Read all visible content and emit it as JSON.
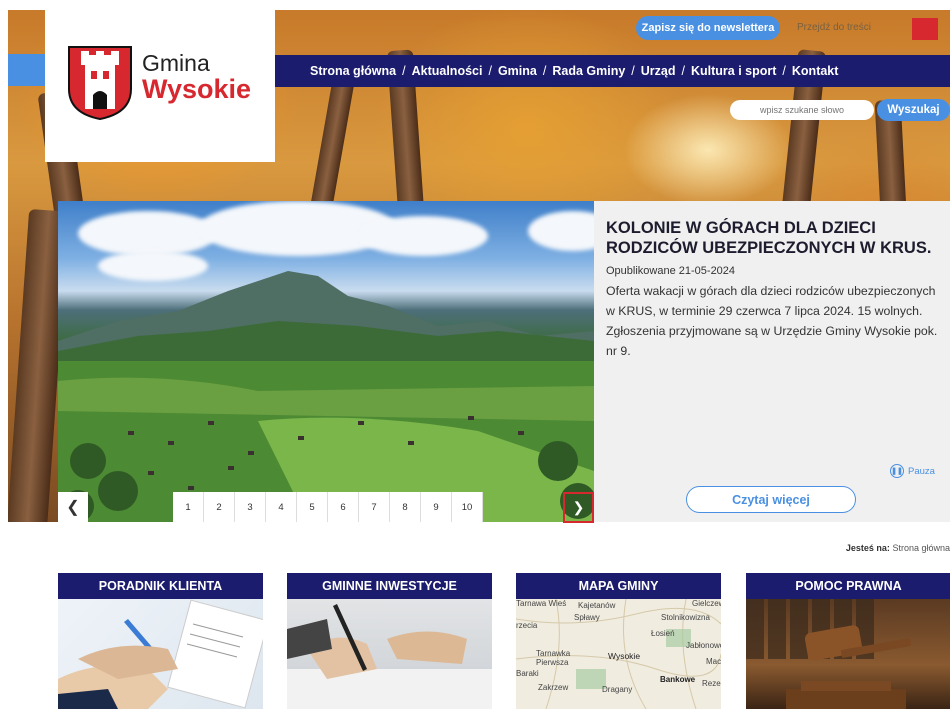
{
  "header": {
    "logo_line1": "Gmina",
    "logo_line2": "Wysokie",
    "newsletter_label": "Zapisz się do newslettera",
    "skip_label": "Przejdź do treści"
  },
  "nav": {
    "items": [
      "Strona główna",
      "Aktualności",
      "Gmina",
      "Rada Gminy",
      "Urząd",
      "Kultura i sport",
      "Kontakt"
    ],
    "separator": "/"
  },
  "search": {
    "placeholder": "wpisz szukane słowo",
    "button_label": "Wyszukaj"
  },
  "slider": {
    "title": "KOLONIE W GÓRACH DLA DZIECI RODZICÓW UBEZPIECZONYCH W KRUS.",
    "date": "Opublikowane 21-05-2024",
    "body": "Oferta wakacji w górach dla dzieci rodziców ubezpieczonych w KRUS, w terminie 29 czerwca 7 lipca 2024. 15 wolnych. Zgłoszenia przyjmowane są w Urzędzie Gminy Wysokie pok. nr 9.",
    "pause_label": "Pauza",
    "read_more_label": "Czytaj więcej",
    "pages": [
      "1",
      "2",
      "3",
      "4",
      "5",
      "6",
      "7",
      "8",
      "9",
      "10"
    ],
    "prev_icon": "chevron-left-icon",
    "next_icon": "chevron-right-icon"
  },
  "breadcrumb": {
    "prefix": "Jesteś na:",
    "current": "Strona główna"
  },
  "cards": [
    {
      "title": "PORADNIK KLIENTA"
    },
    {
      "title": "GMINNE INWESTYCJE"
    },
    {
      "title": "MAPA GMINY"
    },
    {
      "title": "POMOC PRAWNA"
    }
  ],
  "map_labels": [
    "Kajetanów",
    "Gielczew",
    "Spławy",
    "Stolnikowizna",
    "Łosień",
    "Jabłonowo",
    "Tarnawka Pierwsza",
    "Wysokie",
    "Maciejów",
    "Baraki",
    "Bankowe",
    "Rezerwa",
    "Zakrzew",
    "Dragany",
    "Tarnawa Wieś",
    "rzecia"
  ],
  "colors": {
    "navy": "#1c1c6e",
    "accent_blue": "#4a90e2",
    "brand_red": "#d7282f"
  }
}
